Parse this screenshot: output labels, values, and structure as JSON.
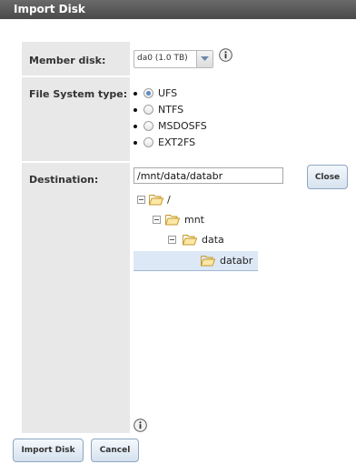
{
  "dialog": {
    "title": "Import Disk"
  },
  "member_disk": {
    "label": "Member disk:",
    "selected": "da0 (1.0 TB)"
  },
  "fs_type": {
    "label": "File System type:",
    "options": [
      "UFS",
      "NTFS",
      "MSDOSFS",
      "EXT2FS"
    ],
    "selected": "UFS"
  },
  "destination": {
    "label": "Destination:",
    "value": "/mnt/data/databr",
    "close_label": "Close",
    "tree": [
      "/",
      "mnt",
      "data",
      "databr"
    ],
    "selected_node": "databr"
  },
  "footer": {
    "import_label": "Import Disk",
    "cancel_label": "Cancel"
  },
  "colors": {
    "accent": "#5a8ac6",
    "label_bg": "#e8e8e8",
    "titlebar": "#555555"
  },
  "icons": {
    "info": "info-icon",
    "folder": "folder-open-icon",
    "collapse": "collapse-icon",
    "dropdown": "chevron-down-icon"
  }
}
